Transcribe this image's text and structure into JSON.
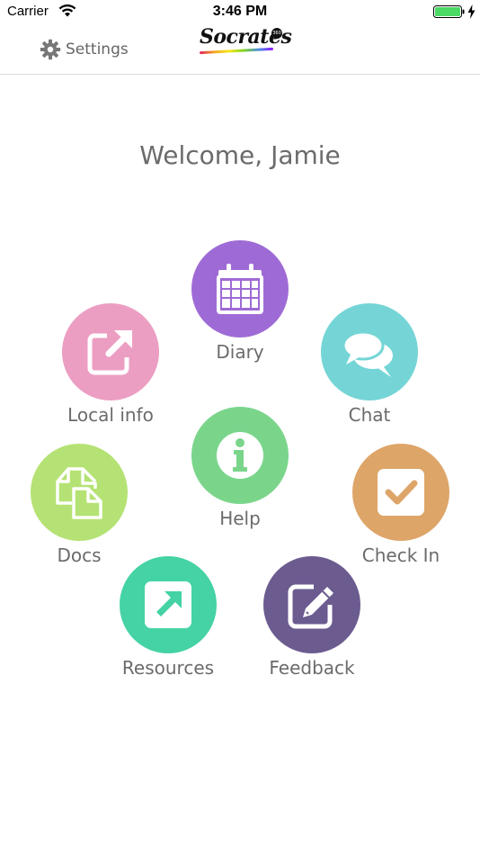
{
  "status_bar": {
    "carrier": "Carrier",
    "time": "3:46 PM"
  },
  "nav": {
    "settings_label": "Settings",
    "logo_text": "Socrates",
    "logo_badge": "360"
  },
  "welcome": "Welcome, Jamie",
  "tiles": [
    {
      "label": "Diary",
      "color": "#9e6bd6",
      "icon": "calendar-icon"
    },
    {
      "label": "Local info",
      "color": "#ec9ec2",
      "icon": "external-link-icon"
    },
    {
      "label": "Chat",
      "color": "#75d5d6",
      "icon": "chat-bubbles-icon"
    },
    {
      "label": "Help",
      "color": "#7ad58b",
      "icon": "info-icon"
    },
    {
      "label": "Docs",
      "color": "#b5e274",
      "icon": "documents-icon"
    },
    {
      "label": "Check In",
      "color": "#dea569",
      "icon": "checkbox-icon"
    },
    {
      "label": "Resources",
      "color": "#45d2a5",
      "icon": "arrow-square-icon"
    },
    {
      "label": "Feedback",
      "color": "#6b5b8f",
      "icon": "edit-icon"
    }
  ]
}
